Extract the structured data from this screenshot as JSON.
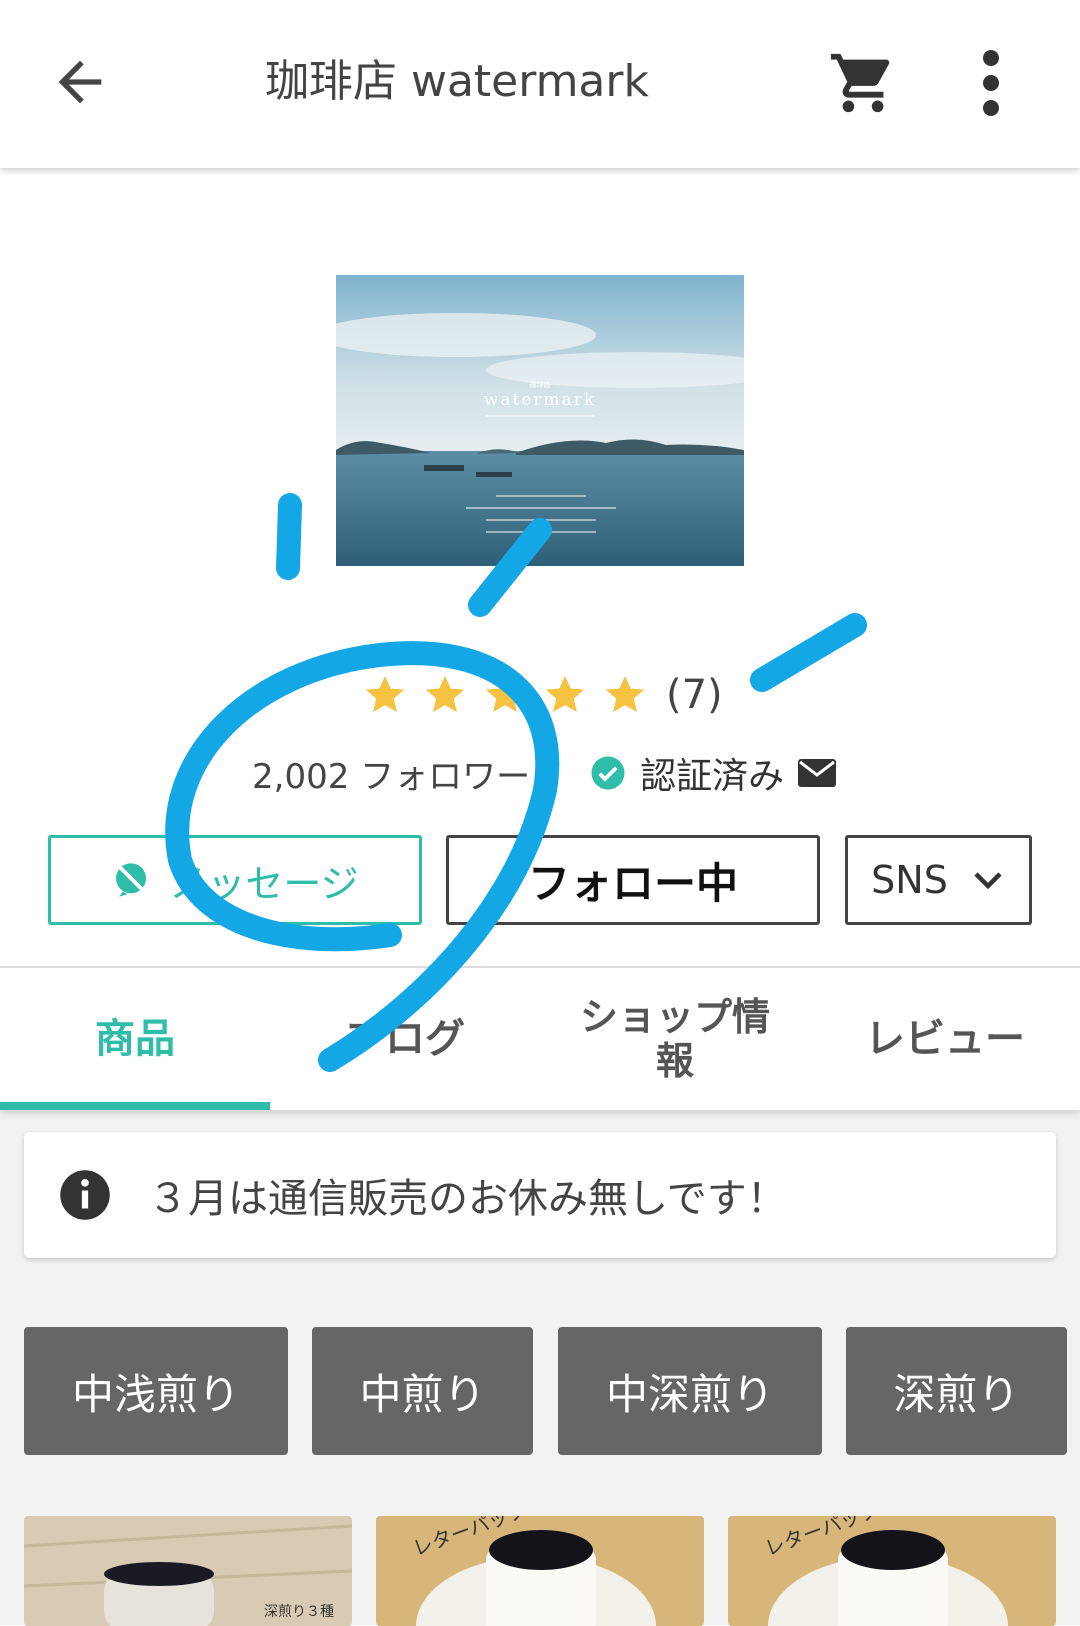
{
  "header": {
    "title": "珈琲店 watermark",
    "back_icon": "arrow-back-icon",
    "cart_icon": "cart-icon",
    "more_icon": "more-vert-icon"
  },
  "cover": {
    "small_title": "珈琲店",
    "brand": "watermark"
  },
  "rating": {
    "stars": 5,
    "max": 5,
    "count_label": "(7)"
  },
  "stats": {
    "followers_label": "2,002 フォロワー",
    "verified_label": "認証済み"
  },
  "actions": {
    "message_label": "メッセージ",
    "follow_label": "フォロー中",
    "sns_label": "SNS"
  },
  "tabs": [
    {
      "label": "商品",
      "active": true
    },
    {
      "label": "ブログ",
      "active": false
    },
    {
      "label": "ショップ情報",
      "active": false
    },
    {
      "label": "レビュー",
      "active": false
    }
  ],
  "notice": {
    "text": "３月は通信販売のお休み無しです！"
  },
  "categories": [
    {
      "label": "中浅煎り"
    },
    {
      "label": "中煎り"
    },
    {
      "label": "中深煎り"
    },
    {
      "label": "深煎り"
    }
  ],
  "products": [
    {
      "caption": "深煎り３種"
    },
    {
      "caption": "レターパックで届く"
    },
    {
      "caption": "レターパックで届く"
    }
  ],
  "colors": {
    "accent": "#2dbda8",
    "star": "#f5c242",
    "category_bg": "#666666",
    "annotation": "#14a7e6"
  }
}
